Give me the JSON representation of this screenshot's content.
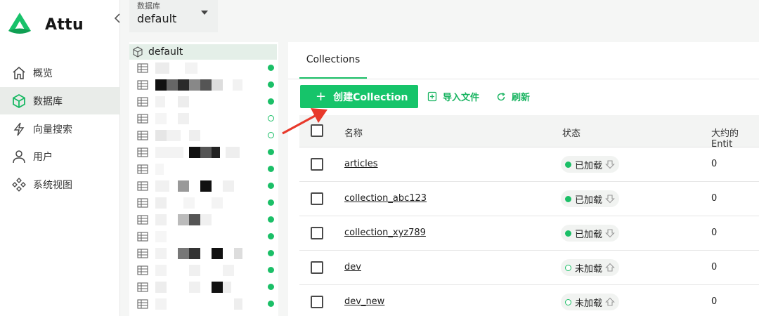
{
  "app": {
    "name": "Attu"
  },
  "nav": {
    "items": [
      {
        "label": "概览",
        "icon": "home-icon",
        "active": false
      },
      {
        "label": "数据库",
        "icon": "cube-icon",
        "active": true
      },
      {
        "label": "向量搜索",
        "icon": "lightning-icon",
        "active": false
      },
      {
        "label": "用户",
        "icon": "user-icon",
        "active": false
      },
      {
        "label": "系统视图",
        "icon": "system-view-icon",
        "active": false
      }
    ]
  },
  "db_selector": {
    "caption": "数据库",
    "value": "default"
  },
  "tree": {
    "root_label": "default",
    "rows": [
      {
        "loaded": true
      },
      {
        "loaded": true
      },
      {
        "loaded": true
      },
      {
        "loaded": false
      },
      {
        "loaded": false
      },
      {
        "loaded": true
      },
      {
        "loaded": true
      },
      {
        "loaded": true
      },
      {
        "loaded": true
      },
      {
        "loaded": true
      },
      {
        "loaded": true
      },
      {
        "loaded": true
      },
      {
        "loaded": true
      },
      {
        "loaded": true
      },
      {
        "loaded": true
      }
    ]
  },
  "main": {
    "tab_label": "Collections",
    "toolbar": {
      "create_label": "创建Collection",
      "import_label": "导入文件",
      "refresh_label": "刷新"
    },
    "table": {
      "headers": {
        "name": "名称",
        "status": "状态",
        "entities": "大约的Entit"
      },
      "rows": [
        {
          "name": "articles",
          "status": "已加载",
          "loaded": true,
          "count": "0"
        },
        {
          "name": "collection_abc123",
          "status": "已加载",
          "loaded": true,
          "count": "0"
        },
        {
          "name": "collection_xyz789",
          "status": "已加载",
          "loaded": true,
          "count": "0"
        },
        {
          "name": "dev",
          "status": "未加载",
          "loaded": false,
          "count": "0"
        },
        {
          "name": "dev_new",
          "status": "未加载",
          "loaded": false,
          "count": "0"
        }
      ]
    }
  },
  "colors": {
    "accent": "#16c46a",
    "annotation": "#e8392b"
  }
}
